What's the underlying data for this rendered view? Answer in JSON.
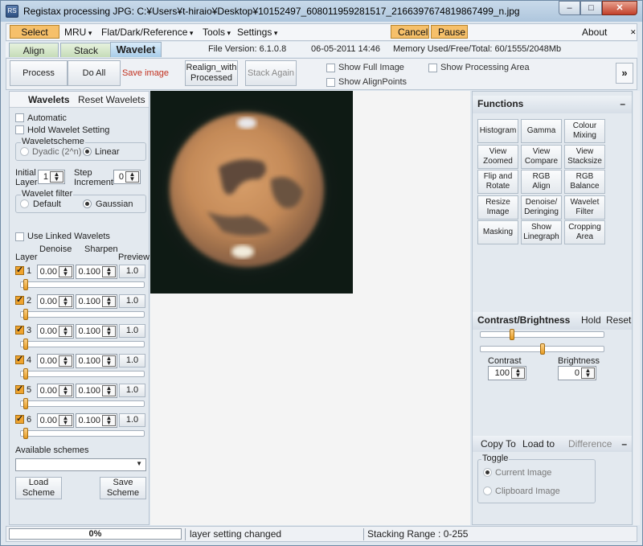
{
  "window": {
    "title": "Registax processing JPG: C:¥Users¥t-hiraio¥Desktop¥10152497_608011959281517_2166397674819867499_n.jpg",
    "app_icon_text": "RS"
  },
  "menu": {
    "select": "Select",
    "mru": "MRU",
    "flat": "Flat/Dark/Reference",
    "tools": "Tools",
    "settings": "Settings",
    "cancel": "Cancel",
    "pause": "Pause",
    "about": "About"
  },
  "tabs": {
    "align": "Align",
    "stack": "Stack",
    "wavelet": "Wavelet"
  },
  "info": {
    "file_version": "File Version: 6.1.0.8",
    "date": "06-05-2011 14:46",
    "memory": "Memory Used/Free/Total: 60/1555/2048Mb"
  },
  "toolbar": {
    "process": "Process",
    "doall": "Do All",
    "save": "Save image",
    "realign_1": "Realign_with",
    "realign_2": "Processed",
    "stackagain": "Stack Again",
    "show_full": "Show Full Image",
    "show_align": "Show AlignPoints",
    "show_proc": "Show Processing Area",
    "more": "»"
  },
  "left": {
    "wavelets": "Wavelets",
    "reset": "Reset Wavelets",
    "automatic": "Automatic",
    "hold": "Hold Wavelet Setting",
    "scheme_title": "Waveletscheme",
    "dyadic": "Dyadic (2^n)",
    "linear": "Linear",
    "initial_1": "Initial",
    "initial_2": "Layer",
    "initial_val": "1",
    "step_1": "Step",
    "step_2": "Increment",
    "step_val": "0",
    "filter_title": "Wavelet filter",
    "default": "Default",
    "gaussian": "Gaussian",
    "linked": "Use Linked Wavelets",
    "denoise": "Denoise",
    "sharpen": "Sharpen",
    "layer": "Layer",
    "preview": "Preview",
    "layers": [
      {
        "n": "1",
        "denoise": "0.00",
        "sharpen": "0.100",
        "preview": "1.0"
      },
      {
        "n": "2",
        "denoise": "0.00",
        "sharpen": "0.100",
        "preview": "1.0"
      },
      {
        "n": "3",
        "denoise": "0.00",
        "sharpen": "0.100",
        "preview": "1.0"
      },
      {
        "n": "4",
        "denoise": "0.00",
        "sharpen": "0.100",
        "preview": "1.0"
      },
      {
        "n": "5",
        "denoise": "0.00",
        "sharpen": "0.100",
        "preview": "1.0"
      },
      {
        "n": "6",
        "denoise": "0.00",
        "sharpen": "0.100",
        "preview": "1.0"
      }
    ],
    "available": "Available schemes",
    "load_1": "Load",
    "load_2": "Scheme",
    "save_1": "Save",
    "save_2": "Scheme"
  },
  "right": {
    "functions": "Functions",
    "collapse": "–",
    "buttons": [
      [
        "Histogram"
      ],
      [
        "Gamma"
      ],
      [
        "Colour",
        "Mixing"
      ],
      [
        "View",
        "Zoomed"
      ],
      [
        "View",
        "Compare"
      ],
      [
        "View",
        "Stacksize"
      ],
      [
        "Flip and",
        "Rotate"
      ],
      [
        "RGB",
        "Align"
      ],
      [
        "RGB",
        "Balance"
      ],
      [
        "Resize",
        "Image"
      ],
      [
        "Denoise/",
        "Deringing"
      ],
      [
        "Wavelet",
        "Filter"
      ],
      [
        "Masking"
      ],
      [
        "Show",
        "Linegraph"
      ],
      [
        "Cropping",
        "Area"
      ]
    ],
    "cb_title": "Contrast/Brightness",
    "hold": "Hold",
    "reset": "Reset",
    "contrast": "Contrast",
    "contrast_val": "100",
    "brightness": "Brightness",
    "brightness_val": "0",
    "copy_to": "Copy To",
    "load_to": "Load to",
    "difference": "Difference",
    "toggle": "Toggle",
    "current": "Current Image",
    "clipboard": "Clipboard Image"
  },
  "status": {
    "progress": "0%",
    "progress_value": 0,
    "message": "layer setting changed",
    "range": "Stacking Range : 0-255"
  },
  "colors": {
    "accent": "#f6c06a",
    "slider_thumb": "#e59a22",
    "active_tab": "#a9cde9"
  }
}
